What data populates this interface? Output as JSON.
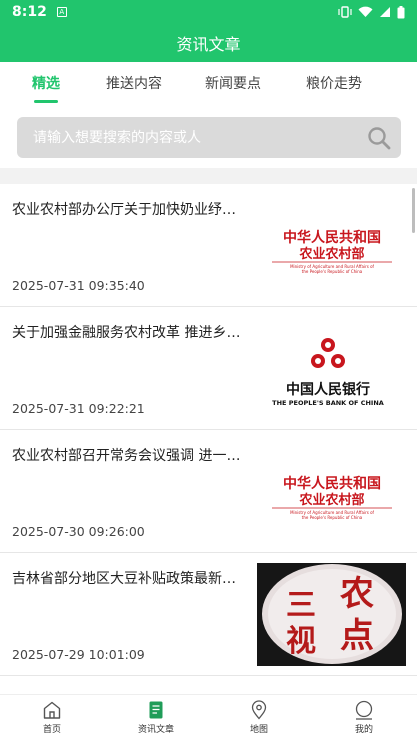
{
  "status_bar": {
    "time": "8:12",
    "notification_icon": "A"
  },
  "header": {
    "title": "资讯文章"
  },
  "tabs": [
    {
      "label": "精选",
      "active": true
    },
    {
      "label": "推送内容",
      "active": false
    },
    {
      "label": "新闻要点",
      "active": false
    },
    {
      "label": "粮价走势",
      "active": false
    }
  ],
  "search": {
    "placeholder": "请输入想要搜索的内容或人",
    "value": ""
  },
  "articles": [
    {
      "title": "农业农村部办公厅关于加快奶业纾…",
      "date": "2025-07-31 09:35:40",
      "thumb": {
        "type": "moa-logo",
        "line1": "中华人民共和国",
        "line2": "农业农村部",
        "line3": "Ministry of Agriculture and Rural Affairs of",
        "line4": "the People's Republic of China"
      }
    },
    {
      "title": "关于加强金融服务农村改革 推进乡…",
      "date": "2025-07-31 09:22:21",
      "thumb": {
        "type": "pboc-logo",
        "line1": "中国人民银行",
        "line2": "THE PEOPLE'S BANK OF CHINA"
      }
    },
    {
      "title": "农业农村部召开常务会议强调 进一…",
      "date": "2025-07-30 09:26:00",
      "thumb": {
        "type": "moa-logo",
        "line1": "中华人民共和国",
        "line2": "农业农村部",
        "line3": "Ministry of Agriculture and Rural Affairs of",
        "line4": "the People's Republic of China"
      }
    },
    {
      "title": "吉林省部分地区大豆补贴政策最新…",
      "date": "2025-07-29 10:01:09",
      "thumb": {
        "type": "seal",
        "chars": [
          "农",
          "三",
          "点",
          "视"
        ]
      }
    }
  ],
  "bottom_nav": [
    {
      "label": "首页",
      "icon": "home-icon",
      "active": false
    },
    {
      "label": "资讯文章",
      "icon": "article-icon",
      "active": true
    },
    {
      "label": "地图",
      "icon": "map-pin-icon",
      "active": false
    },
    {
      "label": "我的",
      "icon": "profile-icon",
      "active": false
    }
  ],
  "colors": {
    "brand_green": "#21c56d",
    "logo_red": "#c8161d",
    "seal_red": "#b41a1a"
  }
}
